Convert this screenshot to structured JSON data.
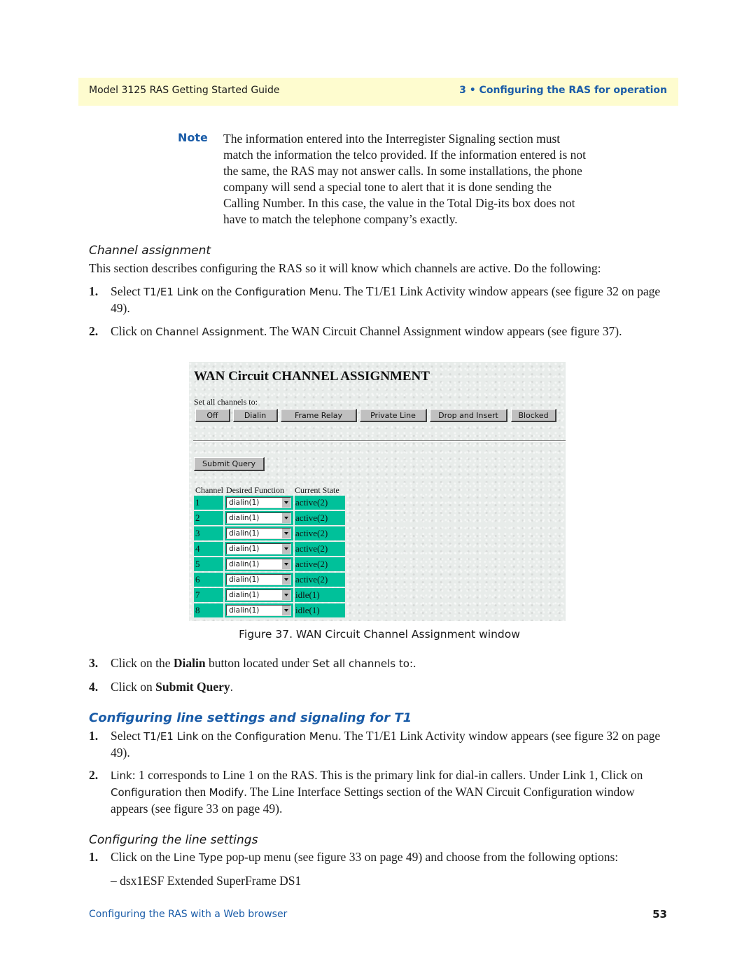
{
  "header": {
    "guide_title": "Model 3125 RAS Getting Started Guide",
    "chapter": "3 • Configuring the RAS for operation"
  },
  "note": {
    "label": "Note",
    "text": "The information entered into the Interregister Signaling section must match the information the telco provided. If the information entered is not the same, the RAS may not answer calls. In some installations, the phone company will send a special tone to alert that it is done sending the Calling Number. In this case, the value in the Total Dig-its box does not have to match the telephone company’s exactly."
  },
  "channel_assignment": {
    "heading": "Channel assignment",
    "intro": "This section describes configuring the RAS so it will know which channels are active. Do the following:",
    "steps": [
      {
        "num": "1.",
        "pre": "Select ",
        "ui": "T1/E1 Link",
        "mid": " on the ",
        "ui2": "Configuration Menu",
        "post": ". The T1/E1 Link Activity window appears (see figure 32 on page 49)."
      },
      {
        "num": "2.",
        "pre": "Click on ",
        "ui": "Channel Assignment",
        "post": ". The WAN Circuit Channel Assignment window appears (see figure 37)."
      }
    ]
  },
  "figure": {
    "title": "WAN Circuit CHANNEL ASSIGNMENT",
    "set_all_label": "Set all channels to:",
    "buttons": [
      "Off",
      "Dialin",
      "Frame Relay",
      "Private Line",
      "Drop and Insert",
      "Blocked"
    ],
    "submit_label": "Submit Query",
    "columns": [
      "Channel",
      "Desired Function",
      "Current State"
    ],
    "rows": [
      {
        "channel": "1",
        "function": "dialin(1)",
        "state": "active(2)"
      },
      {
        "channel": "2",
        "function": "dialin(1)",
        "state": "active(2)"
      },
      {
        "channel": "3",
        "function": "dialin(1)",
        "state": "active(2)"
      },
      {
        "channel": "4",
        "function": "dialin(1)",
        "state": "active(2)"
      },
      {
        "channel": "5",
        "function": "dialin(1)",
        "state": "active(2)"
      },
      {
        "channel": "6",
        "function": "dialin(1)",
        "state": "active(2)"
      },
      {
        "channel": "7",
        "function": "dialin(1)",
        "state": "idle(1)"
      },
      {
        "channel": "8",
        "function": "dialin(1)",
        "state": "idle(1)"
      }
    ],
    "caption": "Figure 37. WAN Circuit Channel Assignment window",
    "cell_color": "#00c19a"
  },
  "after_steps": [
    {
      "num": "3.",
      "pre": "Click on the ",
      "bold": "Dialin",
      "mid": " button located under ",
      "ui": "Set all channels to:",
      "post": "."
    },
    {
      "num": "4.",
      "pre": "Click on ",
      "bold": "Submit Query",
      "post": "."
    }
  ],
  "line_settings": {
    "title": "Configuring line settings and signaling for T1",
    "steps": [
      {
        "num": "1.",
        "pre": "Select ",
        "ui": "T1/E1 Link",
        "mid": " on the ",
        "ui2": "Configuration Menu",
        "post": ". The T1/E1 Link Activity window appears (see figure 32 on page 49)."
      },
      {
        "num": "2.",
        "ui": "Link",
        "pre2": ": 1 corresponds to Line 1 on the RAS. This is the primary link for dial-in callers. Under Link 1, Click on ",
        "ui2": "Configuration",
        "mid": " then ",
        "ui3": "Modify",
        "post": ". The Line Interface Settings section of the WAN Circuit Configuration window appears (see figure 33 on page 49)."
      }
    ],
    "subheading": "Configuring the line settings",
    "sub_steps": [
      {
        "num": "1.",
        "pre": "Click on the ",
        "ui": "Line Type",
        "post": " pop-up menu (see figure 33 on page 49) and choose from the following options:"
      }
    ],
    "option": "– dsx1ESF Extended SuperFrame DS1"
  },
  "footer": {
    "section": "Configuring the RAS with a Web browser",
    "page_number": "53"
  },
  "colors": {
    "accent_blue": "#1a5ca8",
    "header_band": "#fefccf"
  }
}
